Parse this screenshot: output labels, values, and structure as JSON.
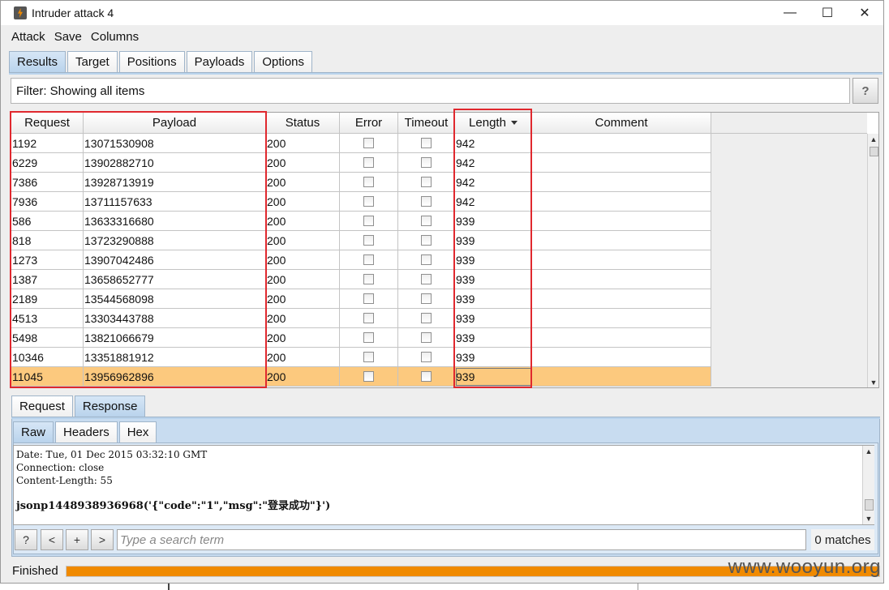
{
  "window": {
    "title": "Intruder attack 4",
    "controls": [
      "—",
      "☐",
      "✕"
    ]
  },
  "menu": [
    "Attack",
    "Save",
    "Columns"
  ],
  "main_tabs": [
    "Results",
    "Target",
    "Positions",
    "Payloads",
    "Options"
  ],
  "filter": {
    "text": "Filter: Showing all items",
    "help": "?"
  },
  "table": {
    "columns": [
      "Request",
      "Payload",
      "Status",
      "Error",
      "Timeout",
      "Length",
      "Comment"
    ],
    "sorted_column": "Length",
    "rows": [
      {
        "request": "1192",
        "payload": "13071530908",
        "status": "200",
        "length": "942"
      },
      {
        "request": "6229",
        "payload": "13902882710",
        "status": "200",
        "length": "942"
      },
      {
        "request": "7386",
        "payload": "13928713919",
        "status": "200",
        "length": "942"
      },
      {
        "request": "7936",
        "payload": "13711157633",
        "status": "200",
        "length": "942"
      },
      {
        "request": "586",
        "payload": "13633316680",
        "status": "200",
        "length": "939"
      },
      {
        "request": "818",
        "payload": "13723290888",
        "status": "200",
        "length": "939"
      },
      {
        "request": "1273",
        "payload": "13907042486",
        "status": "200",
        "length": "939"
      },
      {
        "request": "1387",
        "payload": "13658652777",
        "status": "200",
        "length": "939"
      },
      {
        "request": "2189",
        "payload": "13544568098",
        "status": "200",
        "length": "939"
      },
      {
        "request": "4513",
        "payload": "13303443788",
        "status": "200",
        "length": "939"
      },
      {
        "request": "5498",
        "payload": "13821066679",
        "status": "200",
        "length": "939"
      },
      {
        "request": "10346",
        "payload": "13351881912",
        "status": "200",
        "length": "939"
      },
      {
        "request": "11045",
        "payload": "13956962896",
        "status": "200",
        "length": "939",
        "selected": true
      }
    ]
  },
  "detail_tabs": [
    "Request",
    "Response"
  ],
  "detail_active": "Response",
  "view_tabs": [
    "Raw",
    "Headers",
    "Hex"
  ],
  "view_active": "Raw",
  "response_lines": [
    "Date: Tue, 01 Dec 2015 03:32:10 GMT",
    "Connection: close",
    "Content-Length: 55",
    "",
    "jsonp1448938936968('{\"code\":\"1\",\"msg\":\"登录成功\"}')"
  ],
  "search": {
    "buttons": [
      "?",
      "<",
      "+",
      ">"
    ],
    "placeholder": "Type a search term",
    "matches": "0 matches"
  },
  "status": {
    "text": "Finished",
    "progress": 1.0,
    "progress_color": "#f08a00"
  },
  "watermark": "www.wooyun.org",
  "colors": {
    "selected_row": "#fcc97e",
    "highlight_box": "#e0282e",
    "tab_active": "#b9d3ec"
  }
}
